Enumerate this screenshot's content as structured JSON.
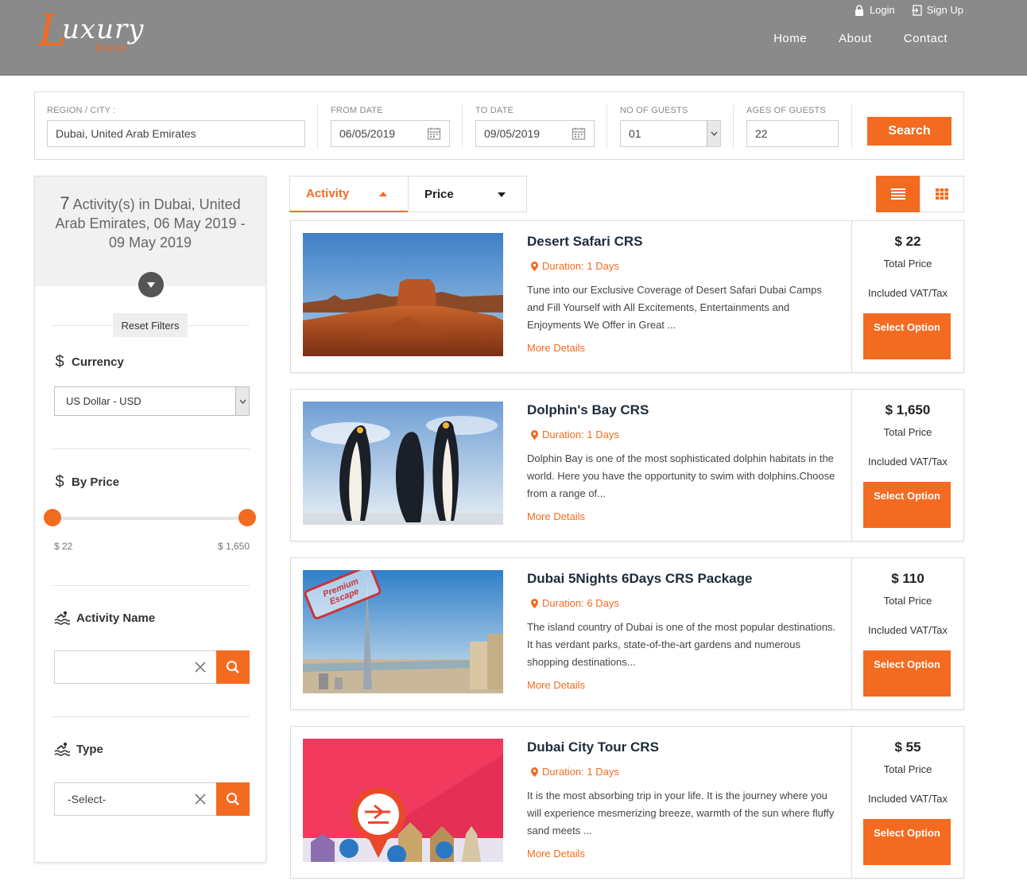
{
  "header": {
    "logo_main": "uxury",
    "logo_initial": "L",
    "logo_sub": "brand",
    "login": "Login",
    "signup": "Sign Up",
    "nav": [
      "Home",
      "About",
      "Contact"
    ]
  },
  "search": {
    "region_label": "REGION / CITY :",
    "region_value": "Dubai, United Arab Emirates",
    "from_label": "FROM DATE",
    "from_value": "06/05/2019",
    "to_label": "TO DATE",
    "to_value": "09/05/2019",
    "guests_label": "NO OF GUESTS",
    "guests_value": "01",
    "ages_label": "AGES OF GUESTS",
    "ages_value": "22",
    "button": "Search"
  },
  "sidebar": {
    "count": "7",
    "summary": "Activity(s) in Dubai, United Arab Emirates, 06 May 2019 - 09 May 2019",
    "reset": "Reset Filters",
    "currency_title": "Currency",
    "currency_value": "US Dollar - USD",
    "price_title": "By Price",
    "price_min": "$ 22",
    "price_max": "$ 1,650",
    "activity_title": "Activity Name",
    "activity_value": "",
    "type_title": "Type",
    "type_value": "-Select-"
  },
  "sort": {
    "activity": "Activity",
    "price": "Price"
  },
  "cards": [
    {
      "title": "Desert Safari CRS",
      "duration": "Duration: 1 Days",
      "desc": "Tune into our Exclusive Coverage of Desert Safari Dubai Camps and Fill Yourself with All Excitements, Entertainments and Enjoyments We Offer in Great ...",
      "more": "More Details",
      "price": "$ 22",
      "total": "Total Price",
      "vat": "Included VAT/Tax",
      "button": "Select Option"
    },
    {
      "title": "Dolphin's Bay CRS",
      "duration": "Duration: 1 Days",
      "desc": "Dolphin Bay is one of the most sophisticated dolphin habitats in the world. Here you have the opportunity to swim with dolphins.Choose from a range of...",
      "more": "More Details",
      "price": "$ 1,650",
      "total": "Total Price",
      "vat": "Included VAT/Tax",
      "button": "Select Option"
    },
    {
      "title": "Dubai 5Nights 6Days CRS Package",
      "duration": "Duration: 6 Days",
      "desc": "The island country of Dubai is one of the most popular destinations. It has verdant parks, state-of-the-art gardens and numerous shopping destinations...",
      "more": "More Details",
      "price": "$ 110",
      "total": "Total Price",
      "vat": "Included VAT/Tax",
      "button": "Select Option",
      "stamp": "Premium Escape"
    },
    {
      "title": "Dubai City Tour CRS",
      "duration": "Duration: 1 Days",
      "desc": "It is the most absorbing trip in your life. It is the journey where you will experience mesmerizing breeze, warmth of the sun where fluffy sand meets ...",
      "more": "More Details",
      "price": "$ 55",
      "total": "Total Price",
      "vat": "Included VAT/Tax",
      "button": "Select Option"
    }
  ],
  "colors": {
    "accent": "#f36b21",
    "header_bg": "#8a8a8a",
    "sidebar_head_bg": "#f1f1f1"
  },
  "icons": [
    "lock-icon",
    "sign-up-icon",
    "calendar-icon",
    "filter-toggle-icon",
    "dollar-icon",
    "swimmer-icon",
    "clear-icon",
    "search-icon",
    "location-pin-icon",
    "list-view-icon",
    "grid-view-icon"
  ]
}
